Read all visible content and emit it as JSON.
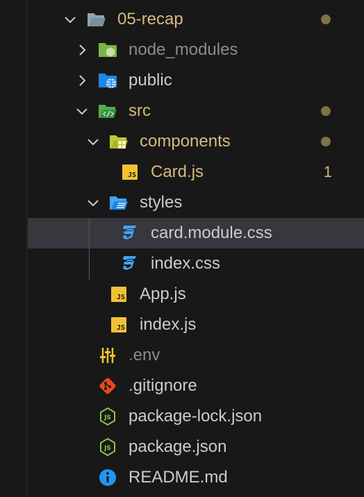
{
  "colors": {
    "background": "#181818",
    "selected_row": "#37373d",
    "modified_yellow": "#d7ba7d",
    "folder_modified": "#d7ba7d",
    "ignored_text": "#8b8b8b",
    "default_text": "#cccccc",
    "git_dot": "#7f7245",
    "js_yellow": "#f1c232",
    "css_blue": "#42a5f5",
    "node_green": "#8bc34a",
    "git_orange": "#e64a19",
    "info_blue": "#2196f3"
  },
  "tree": [
    {
      "label": "05-recap",
      "type": "folder",
      "expanded": true,
      "icon": "folder-open-icon",
      "decoration": "dot",
      "status": "modified"
    },
    {
      "label": "node_modules",
      "type": "folder",
      "expanded": false,
      "icon": "node-folder-icon",
      "status": "ignored"
    },
    {
      "label": "public",
      "type": "folder",
      "expanded": false,
      "icon": "public-folder-icon",
      "status": "normal"
    },
    {
      "label": "src",
      "type": "folder",
      "expanded": true,
      "icon": "src-folder-icon",
      "decoration": "dot",
      "status": "modified"
    },
    {
      "label": "components",
      "type": "folder",
      "expanded": true,
      "icon": "components-folder-icon",
      "decoration": "dot",
      "status": "modified"
    },
    {
      "label": "Card.js",
      "type": "file",
      "icon": "js-icon",
      "icon_text": "JS",
      "decoration": "1",
      "status": "modified"
    },
    {
      "label": "styles",
      "type": "folder",
      "expanded": true,
      "icon": "styles-folder-icon",
      "status": "normal"
    },
    {
      "label": "card.module.css",
      "type": "file",
      "icon": "css-icon",
      "selected": true,
      "status": "normal"
    },
    {
      "label": "index.css",
      "type": "file",
      "icon": "css-icon",
      "status": "normal"
    },
    {
      "label": "App.js",
      "type": "file",
      "icon": "js-icon",
      "icon_text": "JS",
      "status": "normal"
    },
    {
      "label": "index.js",
      "type": "file",
      "icon": "js-icon",
      "icon_text": "JS",
      "status": "normal"
    },
    {
      "label": ".env",
      "type": "file",
      "icon": "settings-sliders-icon",
      "status": "ignored"
    },
    {
      "label": ".gitignore",
      "type": "file",
      "icon": "git-icon",
      "status": "normal"
    },
    {
      "label": "package-lock.json",
      "type": "file",
      "icon": "nodejs-icon",
      "status": "normal"
    },
    {
      "label": "package.json",
      "type": "file",
      "icon": "nodejs-icon",
      "status": "normal"
    },
    {
      "label": "README.md",
      "type": "file",
      "icon": "info-icon",
      "status": "normal"
    }
  ]
}
